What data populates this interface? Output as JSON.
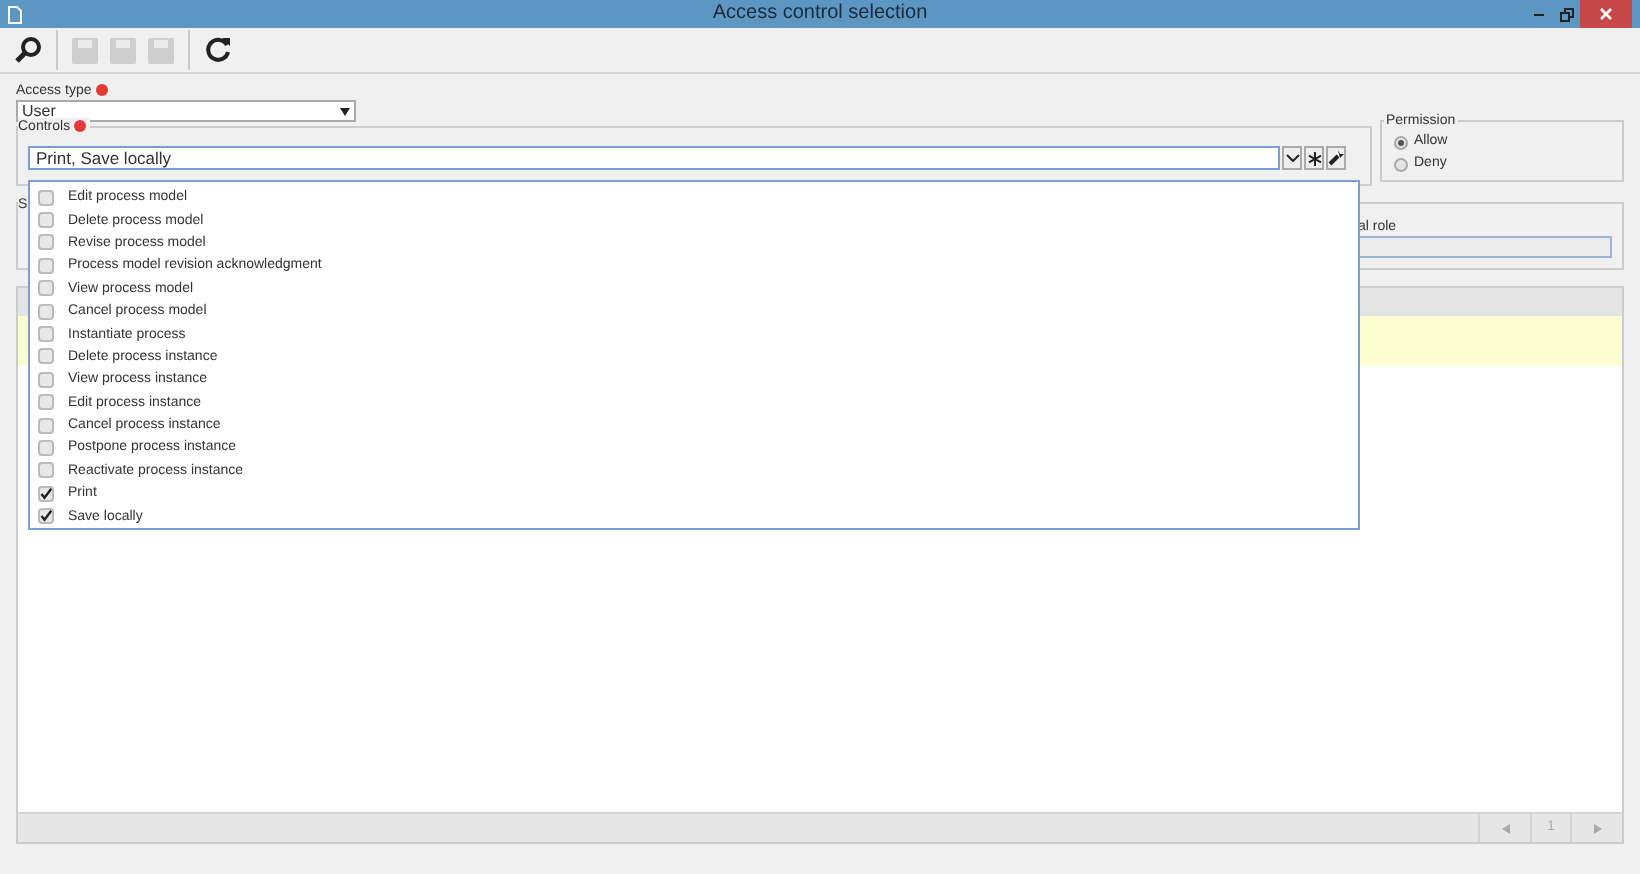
{
  "window": {
    "title": "Access control selection"
  },
  "toolbar": [
    {
      "kind": "search",
      "disabled": false
    },
    {
      "kind": "save",
      "disabled": true
    },
    {
      "kind": "save",
      "disabled": true
    },
    {
      "kind": "save",
      "disabled": true
    },
    {
      "kind": "refresh",
      "disabled": false
    }
  ],
  "access_type": {
    "label": "Access type",
    "required": true,
    "value": "User"
  },
  "controls": {
    "label": "Controls",
    "required": true,
    "value": "Print, Save locally",
    "expanded": true,
    "options": [
      {
        "label": "Edit process model",
        "checked": false
      },
      {
        "label": "Delete process model",
        "checked": false
      },
      {
        "label": "Revise process model",
        "checked": false
      },
      {
        "label": "Process model revision acknowledgment",
        "checked": false
      },
      {
        "label": "View process model",
        "checked": false
      },
      {
        "label": "Cancel process model",
        "checked": false
      },
      {
        "label": "Instantiate process",
        "checked": false
      },
      {
        "label": "Delete process instance",
        "checked": false
      },
      {
        "label": "View process instance",
        "checked": false
      },
      {
        "label": "Edit process instance",
        "checked": false
      },
      {
        "label": "Cancel process instance",
        "checked": false
      },
      {
        "label": "Postpone process instance",
        "checked": false
      },
      {
        "label": "Reactivate process instance",
        "checked": false
      },
      {
        "label": "Print",
        "checked": true
      },
      {
        "label": "Save locally",
        "checked": true
      }
    ]
  },
  "permission": {
    "label": "Permission",
    "options": [
      {
        "label": "Allow",
        "selected": true
      },
      {
        "label": "Deny",
        "selected": false
      }
    ]
  },
  "section_2": {
    "label_cut": "S",
    "field_label": "al role"
  },
  "grid": {
    "pager": {
      "page": "1"
    }
  }
}
